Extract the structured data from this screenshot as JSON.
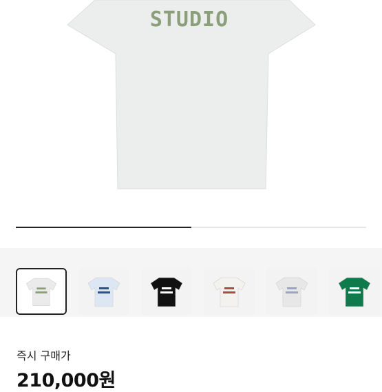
{
  "product": {
    "print_text": "STUDIO",
    "image_progress": 0.5,
    "shirt_color": "#eceeed",
    "print_color": "#8a9f7a"
  },
  "thumbnails": [
    {
      "shirt": "#ebebeb",
      "print": "#8a9f7a",
      "selected": true
    },
    {
      "shirt": "#dde7f3",
      "print": "#2f4f8a",
      "selected": false
    },
    {
      "shirt": "#111111",
      "print": "#ffffff",
      "selected": false
    },
    {
      "shirt": "#f4f2ef",
      "print": "#b04a4a",
      "selected": false
    },
    {
      "shirt": "#e7e7e7",
      "print": "#9aa5c0",
      "selected": false
    },
    {
      "shirt": "#0f7a4b",
      "print": "#ffffff",
      "selected": false
    }
  ],
  "purchase": {
    "label": "즉시 구매가",
    "price": "210,000원"
  }
}
